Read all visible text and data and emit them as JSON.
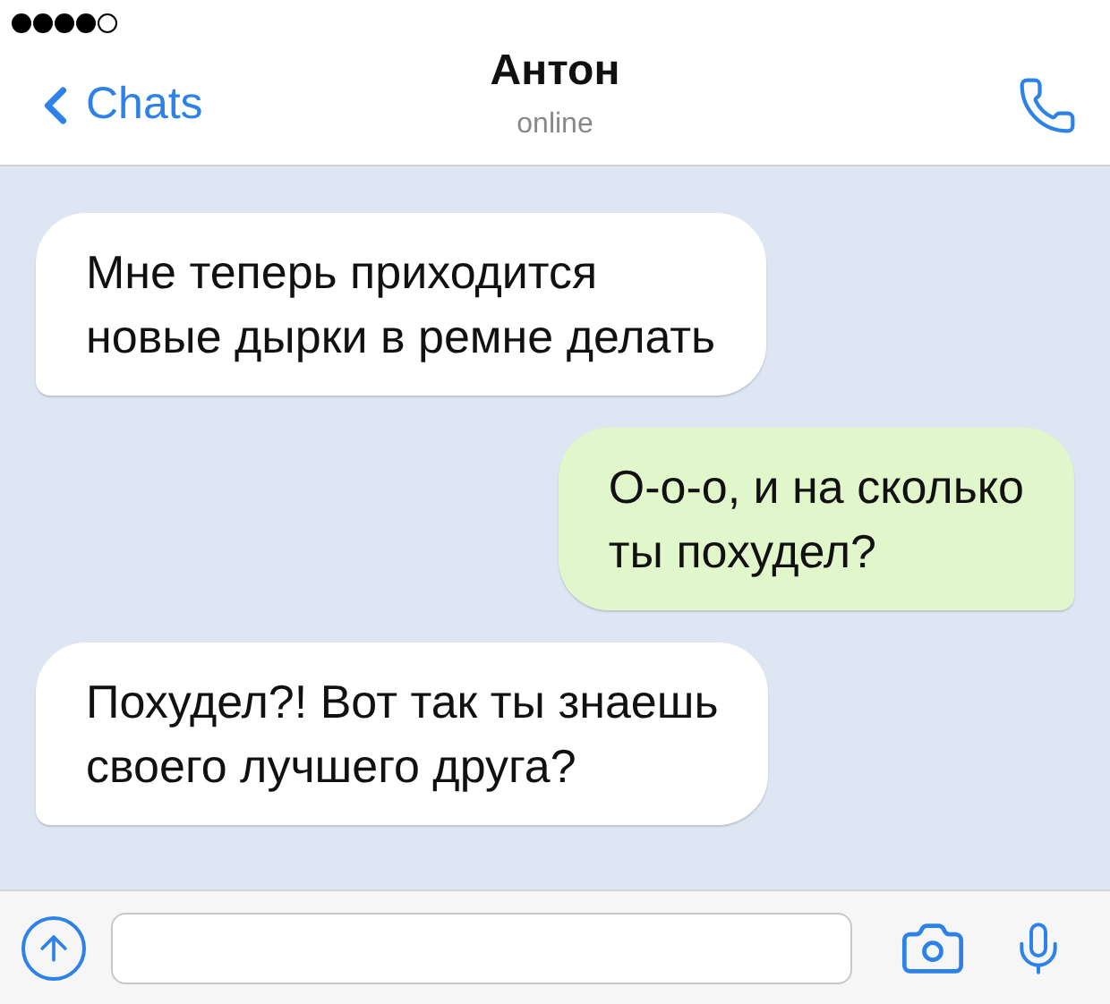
{
  "nav": {
    "back": "Chats",
    "title": "Антон",
    "subtitle": "online"
  },
  "messages": [
    {
      "kind": "incoming",
      "text": "Мне теперь приходится\nновые дырки в ремне делать"
    },
    {
      "kind": "outgoing",
      "text": "О-о-о, и на сколько\nты похудел?"
    },
    {
      "kind": "incoming",
      "text": "Похудел?! Вот так ты знаешь\nсвоего лучшего друга?"
    }
  ]
}
